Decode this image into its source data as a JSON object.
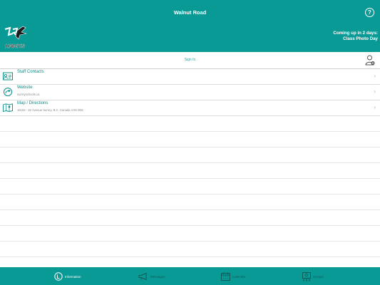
{
  "app": {
    "title": "Walnut Road",
    "help_icon": "help-circle-icon"
  },
  "banner": {
    "logo_text": "HAWKS",
    "upcoming_line1": "Coming up in 2 days:",
    "upcoming_line2": "Class Photo Day"
  },
  "signin": {
    "label": "Sign In",
    "icon": "user-add-icon"
  },
  "list": {
    "items": [
      {
        "title": "Staff Contacts",
        "subtitle": "",
        "icon": "contact-card-icon"
      },
      {
        "title": "Website",
        "subtitle": "surreyschools.ca",
        "icon": "share-arrow-icon"
      },
      {
        "title": "Map / Directions",
        "subtitle": "16152 - 82 Avenue Surrey, B.C. Canada V4N 0N5",
        "icon": "map-icon"
      }
    ]
  },
  "tabs": [
    {
      "label": "Information",
      "icon": "info-icon",
      "active": true
    },
    {
      "label": "Messages",
      "icon": "megaphone-icon",
      "active": false
    },
    {
      "label": "Calendar",
      "icon": "calendar-icon",
      "active": false
    },
    {
      "label": "Groups",
      "icon": "groups-icon",
      "active": false
    }
  ],
  "colors": {
    "primary": "#0a9a96",
    "link": "#0a8c88",
    "inactive_tab": "#0e5a57"
  }
}
